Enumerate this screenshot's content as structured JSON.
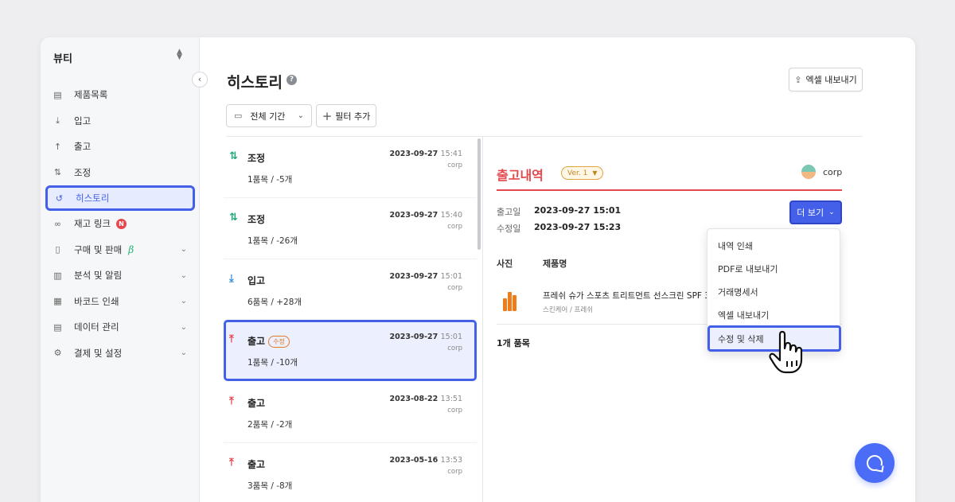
{
  "sidebar": {
    "store_name": "뷰티",
    "items": [
      {
        "label": "제품목록",
        "icon": "box-icon"
      },
      {
        "label": "입고",
        "icon": "arrow-down-icon"
      },
      {
        "label": "출고",
        "icon": "arrow-up-icon"
      },
      {
        "label": "조정",
        "icon": "swap-icon"
      },
      {
        "label": "히스토리",
        "icon": "history-icon",
        "active": true
      },
      {
        "label": "재고 링크",
        "icon": "link-icon",
        "badge": "N"
      },
      {
        "label": "구매 및 판매",
        "icon": "document-icon",
        "beta": "β"
      },
      {
        "label": "분석 및 알림",
        "icon": "chart-icon"
      },
      {
        "label": "바코드 인쇄",
        "icon": "barcode-icon"
      },
      {
        "label": "데이터 관리",
        "icon": "database-icon"
      },
      {
        "label": "결제 및 설정",
        "icon": "settings-icon"
      }
    ]
  },
  "header": {
    "title": "히스토리",
    "help": "?",
    "excel_label": "엑셀 내보내기"
  },
  "filters": {
    "period_label": "전체 기간",
    "add_filter_label": "필터 추가"
  },
  "history": [
    {
      "type": "조정",
      "kind": "adjust",
      "date": "2023-09-27",
      "time": "15:41",
      "user": "corp",
      "summary": "1품목 / -5개"
    },
    {
      "type": "조정",
      "kind": "adjust",
      "date": "2023-09-27",
      "time": "15:40",
      "user": "corp",
      "summary": "1품목 / -26개"
    },
    {
      "type": "입고",
      "kind": "in",
      "date": "2023-09-27",
      "time": "15:01",
      "user": "corp",
      "summary": "6품목 / +28개"
    },
    {
      "type": "출고",
      "kind": "out",
      "tag": "수정",
      "date": "2023-09-27",
      "time": "15:01",
      "user": "corp",
      "summary": "1품목 / -10개",
      "selected": true
    },
    {
      "type": "출고",
      "kind": "out",
      "date": "2023-08-22",
      "time": "13:51",
      "user": "corp",
      "summary": "2품목 / -2개"
    },
    {
      "type": "출고",
      "kind": "out",
      "date": "2023-05-16",
      "time": "13:53",
      "user": "corp",
      "summary": "3품목 / -8개"
    }
  ],
  "detail": {
    "title": "출고내역",
    "version": "Ver. 1",
    "user": "corp",
    "date_label": "출고일",
    "date_value": "2023-09-27 15:01",
    "modified_label": "수정일",
    "modified_value": "2023-09-27 15:23",
    "more_label": "더 보기",
    "col_photo": "사진",
    "col_name": "제품명",
    "product_name": "프레쉬 슈가 스포츠 트리트먼트 선스크린 SPF 30",
    "product_category": "스킨케어 / 프레쉬",
    "count_text": "1개 품목"
  },
  "dropdown": {
    "items": [
      "내역 인쇄",
      "PDF로 내보내기",
      "거래명세서",
      "엑셀 내보내기",
      "수정 및 삭제"
    ]
  }
}
